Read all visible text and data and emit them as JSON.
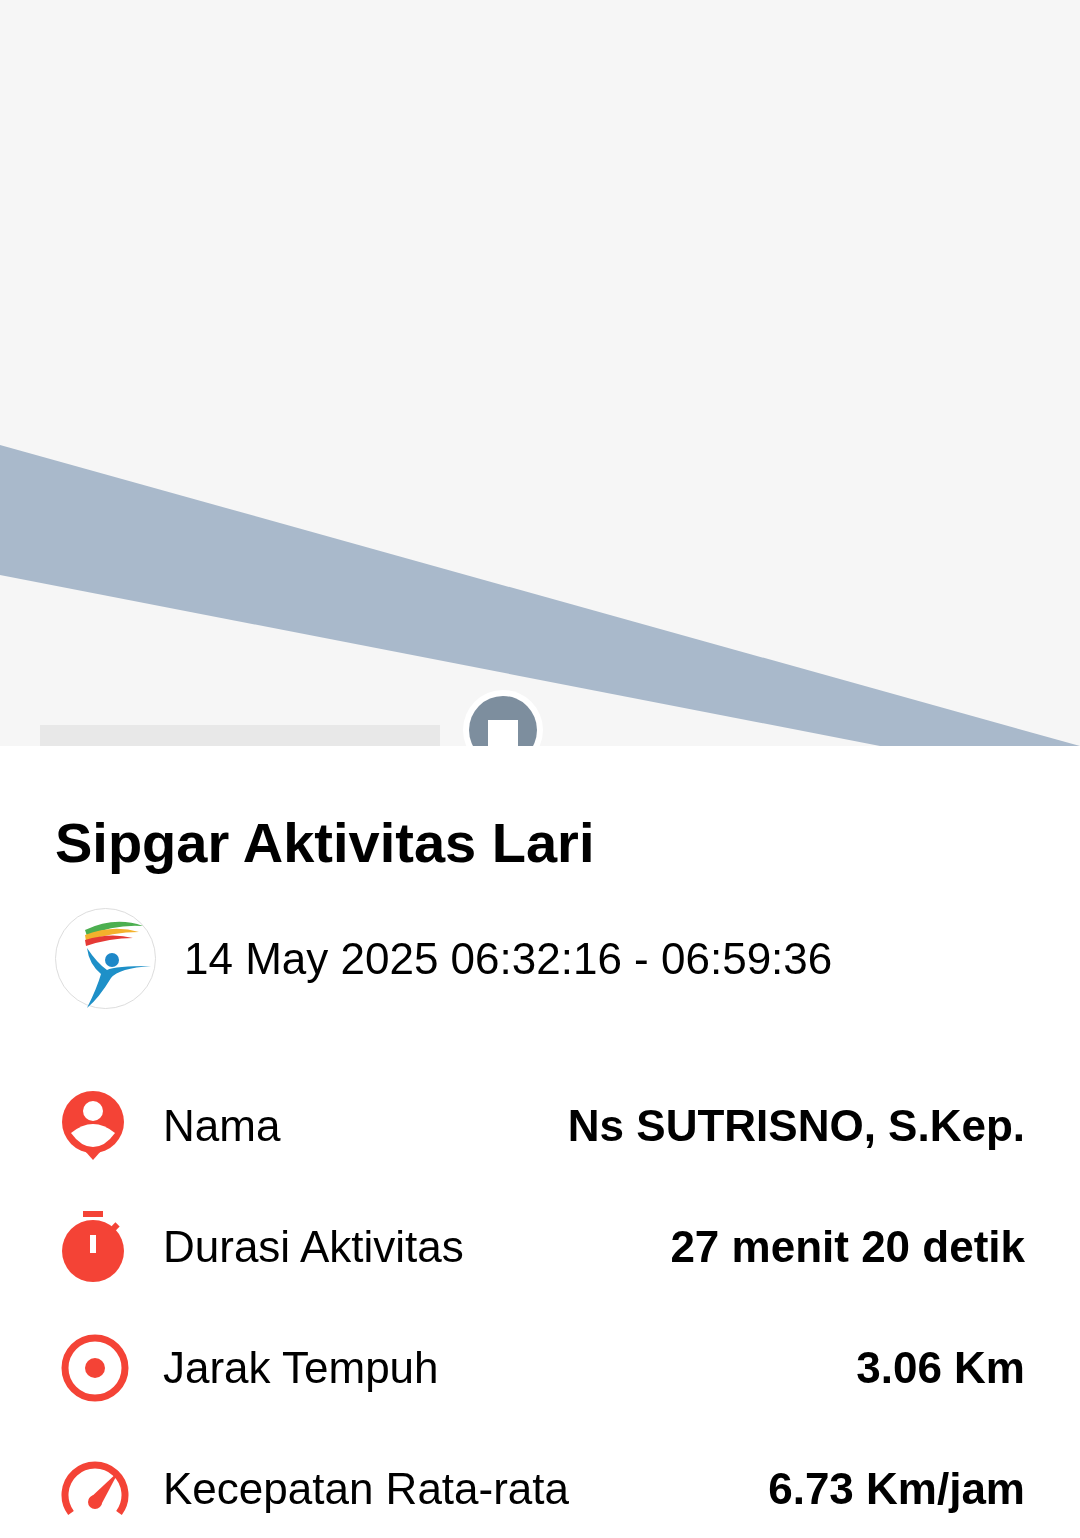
{
  "title": "Sipgar Aktivitas Lari",
  "session": {
    "time_range": "14 May 2025 06:32:16 - 06:59:36"
  },
  "stats": [
    {
      "kind": "person",
      "label": "Nama",
      "value": "Ns SUTRISNO, S.Kep."
    },
    {
      "kind": "stopwatch",
      "label": "Durasi Aktivitas",
      "value": "27 menit 20 detik"
    },
    {
      "kind": "target",
      "label": "Jarak Tempuh",
      "value": "3.06 Km"
    },
    {
      "kind": "speed",
      "label": "Kecepatan Rata-rata",
      "value": "6.73 Km/jam"
    }
  ]
}
